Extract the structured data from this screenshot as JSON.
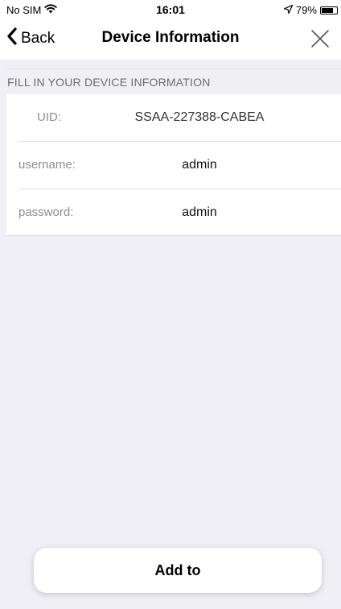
{
  "status_bar": {
    "carrier": "No SIM",
    "time": "16:01",
    "battery_percent": "79%",
    "battery_level": 0.79,
    "icons": [
      "wifi-icon",
      "location-arrow-icon",
      "battery-icon"
    ]
  },
  "nav": {
    "back_label": "Back",
    "title": "Device Information",
    "icons": [
      "chevron-left-icon",
      "close-icon"
    ]
  },
  "section": {
    "header": "FILL IN YOUR DEVICE INFORMATION"
  },
  "form": {
    "uid": {
      "label": "UID:",
      "value": "SSAA-227388-CABEA"
    },
    "username": {
      "label": "username:",
      "value": "admin"
    },
    "password": {
      "label": "password:",
      "value": "admin"
    }
  },
  "actions": {
    "add_label": "Add to"
  },
  "colors": {
    "background": "#f0eff5",
    "card": "#ffffff",
    "label_gray": "#8e8e93",
    "section_gray": "#6d6d72"
  }
}
